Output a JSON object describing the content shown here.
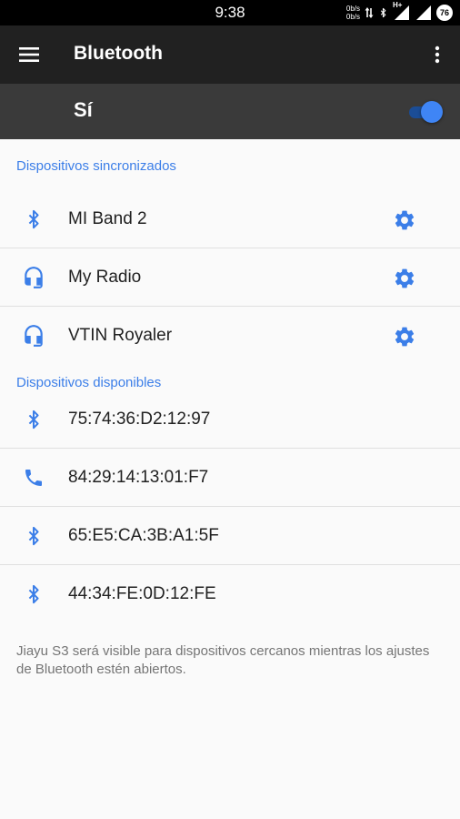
{
  "status_bar": {
    "time": "9:38",
    "net_up": "0b/s",
    "net_down": "0b/s",
    "network_type": "H+",
    "battery": "76",
    "icons": [
      "data-arrows-icon",
      "bluetooth-icon",
      "signal-icon",
      "battery-icon"
    ]
  },
  "toolbar": {
    "title": "Bluetooth",
    "menu_icon": "hamburger-icon",
    "overflow_icon": "more-vert-icon"
  },
  "master_switch": {
    "label": "Sí",
    "state": "on"
  },
  "paired": {
    "header": "Dispositivos sincronizados",
    "devices": [
      {
        "name": "MI Band 2",
        "icon": "bluetooth-icon"
      },
      {
        "name": "My Radio",
        "icon": "headset-icon"
      },
      {
        "name": "VTIN Royaler",
        "icon": "headset-icon"
      }
    ]
  },
  "available": {
    "header": "Dispositivos disponibles",
    "devices": [
      {
        "name": "75:74:36:D2:12:97",
        "icon": "bluetooth-icon"
      },
      {
        "name": "84:29:14:13:01:F7",
        "icon": "phone-icon"
      },
      {
        "name": "65:E5:CA:3B:A1:5F",
        "icon": "bluetooth-icon"
      },
      {
        "name": "44:34:FE:0D:12:FE",
        "icon": "bluetooth-icon"
      }
    ]
  },
  "footer_note": "Jiayu S3 será visible para dispositivos cercanos mientras los ajustes de Bluetooth estén abiertos.",
  "colors": {
    "accent": "#3b7ee8",
    "toolbar": "#212121",
    "master_row": "#3a3a3a",
    "status_bar": "#000000"
  }
}
